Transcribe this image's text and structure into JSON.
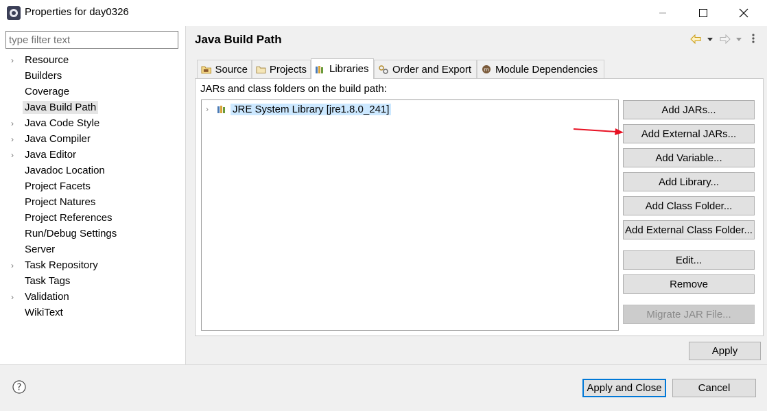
{
  "window": {
    "title": "Properties for day0326"
  },
  "filter": {
    "placeholder": "type filter text"
  },
  "nav": {
    "items": [
      {
        "label": "Resource",
        "expandable": true
      },
      {
        "label": "Builders",
        "expandable": false
      },
      {
        "label": "Coverage",
        "expandable": false
      },
      {
        "label": "Java Build Path",
        "expandable": false,
        "selected": true
      },
      {
        "label": "Java Code Style",
        "expandable": true
      },
      {
        "label": "Java Compiler",
        "expandable": true
      },
      {
        "label": "Java Editor",
        "expandable": true
      },
      {
        "label": "Javadoc Location",
        "expandable": false
      },
      {
        "label": "Project Facets",
        "expandable": false
      },
      {
        "label": "Project Natures",
        "expandable": false
      },
      {
        "label": "Project References",
        "expandable": false
      },
      {
        "label": "Run/Debug Settings",
        "expandable": false
      },
      {
        "label": "Server",
        "expandable": false
      },
      {
        "label": "Task Repository",
        "expandable": true
      },
      {
        "label": "Task Tags",
        "expandable": false
      },
      {
        "label": "Validation",
        "expandable": true
      },
      {
        "label": "WikiText",
        "expandable": false
      }
    ]
  },
  "page": {
    "title": "Java Build Path"
  },
  "tabs": [
    {
      "label": "Source",
      "icon": "source-folder-icon"
    },
    {
      "label": "Projects",
      "icon": "projects-icon"
    },
    {
      "label": "Libraries",
      "icon": "libraries-icon",
      "active": true
    },
    {
      "label": "Order and Export",
      "icon": "order-export-icon"
    },
    {
      "label": "Module Dependencies",
      "icon": "module-icon"
    }
  ],
  "libraries": {
    "description": "JARs and class folders on the build path:",
    "tree": [
      {
        "label": "JRE System Library [jre1.8.0_241]",
        "selected": true
      }
    ],
    "buttons": {
      "add_jars": "Add JARs...",
      "add_external_jars": "Add External JARs...",
      "add_variable": "Add Variable...",
      "add_library": "Add Library...",
      "add_class_folder": "Add Class Folder...",
      "add_external_class_folder": "Add External Class Folder...",
      "edit": "Edit...",
      "remove": "Remove",
      "migrate_jar": "Migrate JAR File..."
    }
  },
  "actions": {
    "apply": "Apply",
    "apply_and_close": "Apply and Close",
    "cancel": "Cancel"
  },
  "colors": {
    "selection": "#cce8ff",
    "annotation_arrow": "#e81123",
    "default_button_border": "#0078d7"
  }
}
